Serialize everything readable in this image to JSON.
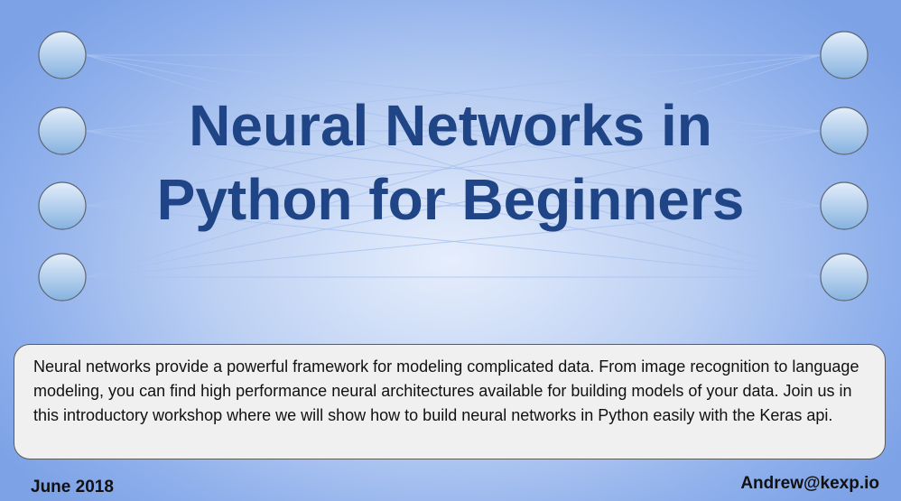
{
  "slide": {
    "title_line1": "Neural Networks in",
    "title_line2": "Python for Beginners",
    "description": "Neural networks provide a powerful framework for modeling complicated data. From image recognition to language modeling, you can find high performance neural architectures available for building models of your data. Join us in this introductory workshop where we will show how to build neural networks in Python easily with the Keras api.",
    "date": "June 2018",
    "contact": "Andrew@kexp.io"
  },
  "network": {
    "input_nodes": 4,
    "output_nodes": 4,
    "colors": {
      "node_light": "#e4eefa",
      "node_dark": "#86b2e0",
      "node_stroke": "#5d6672",
      "edge": "#a9c2ef"
    }
  }
}
